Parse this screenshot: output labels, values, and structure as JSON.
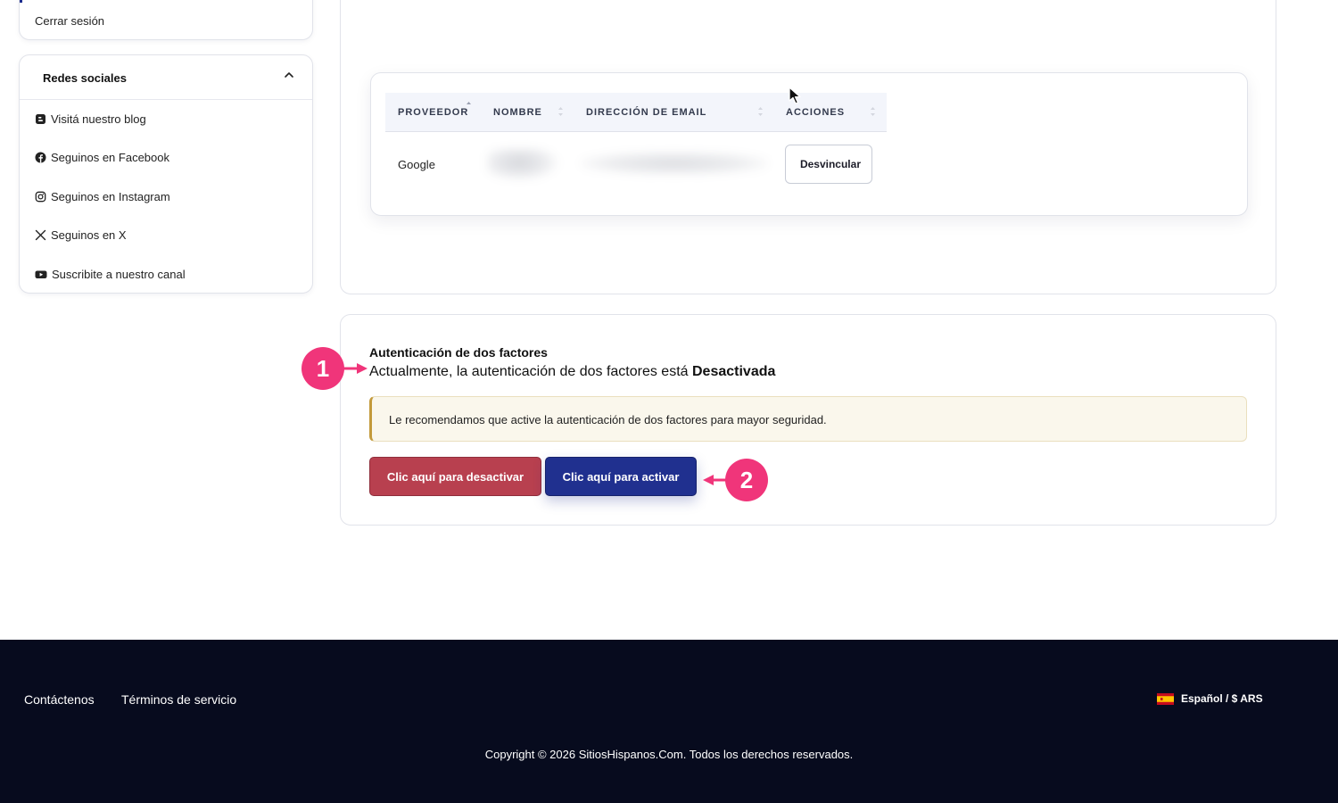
{
  "sidebar": {
    "logout_label": "Cerrar sesión",
    "social": {
      "title": "Redes sociales",
      "items": [
        {
          "icon": "blogger-icon",
          "label": "Visitá nuestro blog"
        },
        {
          "icon": "facebook-icon",
          "label": "Seguinos en Facebook"
        },
        {
          "icon": "instagram-icon",
          "label": "Seguinos en Instagram"
        },
        {
          "icon": "x-icon",
          "label": "Seguinos en X"
        },
        {
          "icon": "youtube-icon",
          "label": "Suscribite a nuestro canal"
        }
      ]
    }
  },
  "linked_accounts": {
    "columns": [
      "PROVEEDOR",
      "NOMBRE",
      "DIRECCIÓN DE EMAIL",
      "ACCIONES"
    ],
    "rows": [
      {
        "provider": "Google",
        "action": "Desvincular"
      }
    ]
  },
  "twofa": {
    "title": "Autenticación de dos factores",
    "status_prefix": "Actualmente, la autenticación de dos factores está",
    "status_value": "Desactivada",
    "alert": "Le recomendamos que active la autenticación de dos factores para mayor seguridad.",
    "deactivate_label": "Clic aquí para desactivar",
    "activate_label": "Clic aquí para activar"
  },
  "annotations": {
    "badge1": "1",
    "badge2": "2",
    "color": "#f0357a"
  },
  "footer": {
    "links": [
      "Contáctenos",
      "Términos de servicio"
    ],
    "lang_currency": "Español / $ ARS",
    "copyright": "Copyright © 2026 SitiosHispanos.Com. Todos los derechos reservados."
  },
  "colors": {
    "deactivate": "#b8404f",
    "activate": "#20308f",
    "footer_bg": "#070b1e",
    "alert_border": "#c39a3b"
  }
}
